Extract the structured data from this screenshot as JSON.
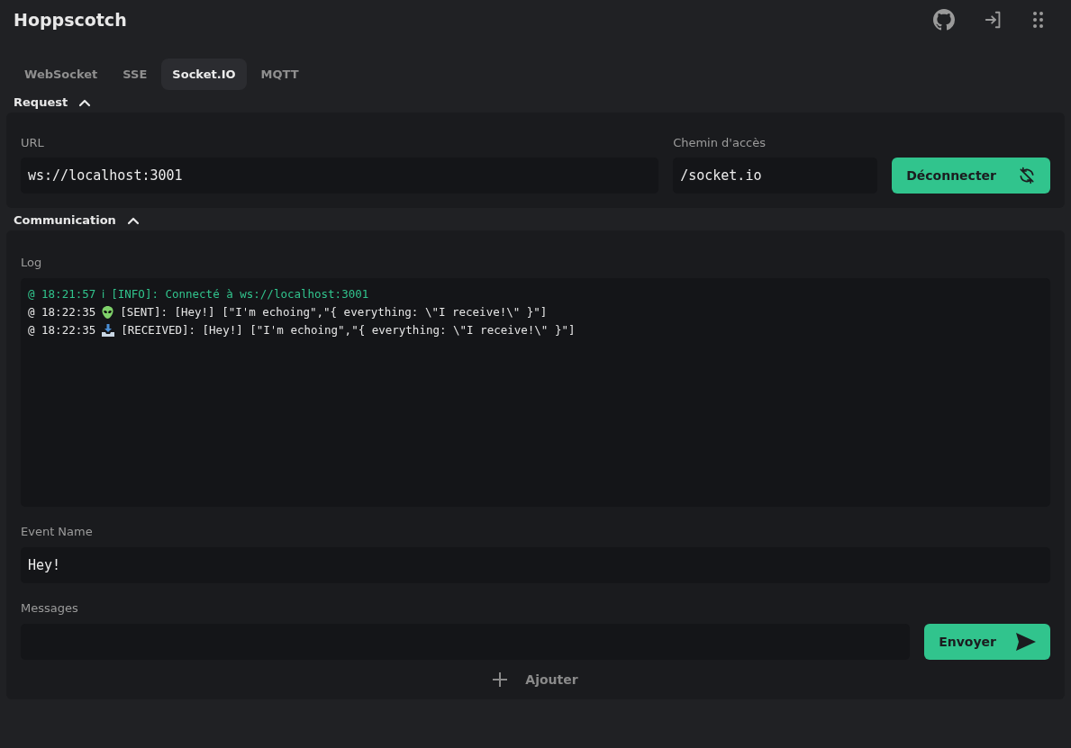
{
  "app": {
    "title": "Hoppscotch"
  },
  "tabs": [
    {
      "label": "WebSocket",
      "selected": false
    },
    {
      "label": "SSE",
      "selected": false
    },
    {
      "label": "Socket.IO",
      "selected": true
    },
    {
      "label": "MQTT",
      "selected": false
    }
  ],
  "request": {
    "heading": "Request",
    "expanded": true,
    "url_label": "URL",
    "url": "ws://localhost:3001",
    "path_label": "Chemin d'accès",
    "path": "/socket.io",
    "connect_button": "Déconnecter"
  },
  "communication": {
    "heading": "Communication",
    "expanded": true,
    "log_label": "Log",
    "log": [
      {
        "kind": "info",
        "time": "@ 18:21:57",
        "marker": "ℹ",
        "text": "[INFO]: Connecté à ws://localhost:3001"
      },
      {
        "kind": "sent",
        "time": "@ 18:22:35",
        "text": "[SENT]: [Hey!] [\"I'm echoing\",\"{ everything: \\\"I receive!\\\" }\"]"
      },
      {
        "kind": "received",
        "time": "@ 18:22:35",
        "text": "[RECEIVED]: [Hey!] [\"I'm echoing\",\"{ everything: \\\"I receive!\\\" }\"]"
      }
    ],
    "event_label": "Event Name",
    "event": "Hey!",
    "messages_label": "Messages",
    "send_button": "Envoyer",
    "add_button": "Ajouter"
  }
}
